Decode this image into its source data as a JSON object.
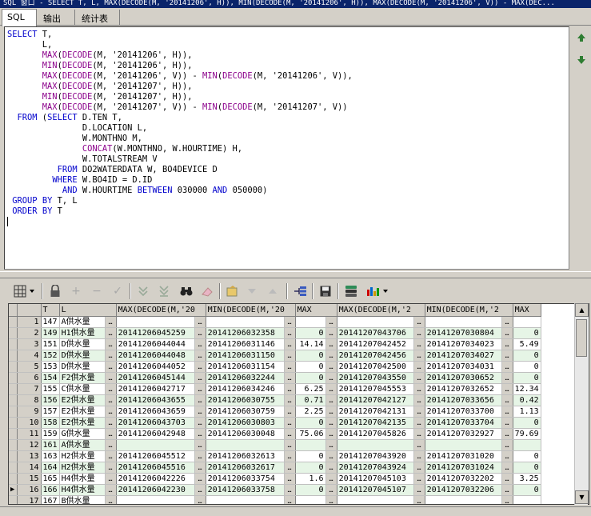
{
  "window": {
    "title": "SQL 窗口 - SELECT T, L, MAX(DECODE(M, '20141206', H)), MIN(DECODE(M, '20141206', H)), MAX(DECODE(M, '20141206', V)) - MAX(DEC..."
  },
  "tabs": [
    {
      "label": "SQL"
    },
    {
      "label": "输出"
    },
    {
      "label": "统计表"
    }
  ],
  "editor": {
    "lines": [
      "SELECT T,",
      "       L,",
      "       MAX(DECODE(M, '20141206', H)),",
      "       MIN(DECODE(M, '20141206', H)),",
      "       MAX(DECODE(M, '20141206', V)) - MIN(DECODE(M, '20141206', V)),",
      "       MAX(DECODE(M, '20141207', H)),",
      "       MIN(DECODE(M, '20141207', H)),",
      "       MAX(DECODE(M, '20141207', V)) - MIN(DECODE(M, '20141207', V))",
      "  FROM (SELECT D.TEN T,",
      "               D.LOCATION L,",
      "               W.MONTHNO M,",
      "               CONCAT(W.MONTHNO, W.HOURTIME) H,",
      "               W.TOTALSTREAM V",
      "          FROM DO2WATERDATA W, BO4DEVICE D",
      "         WHERE W.BO4ID = D.ID",
      "           AND W.HOURTIME BETWEEN 030000 AND 050000)",
      " GROUP BY T, L",
      " ORDER BY T"
    ]
  },
  "side_nav": {
    "up_icon": "arrow-up-icon",
    "down_icon": "arrow-down-icon"
  },
  "toolbar": {
    "icons": [
      "grid-menu-icon",
      "lock-icon",
      "plus-icon",
      "minus-icon",
      "check-icon",
      "next-record-icon",
      "last-record-icon",
      "binoculars-icon",
      "eraser-icon",
      "fetch-icon",
      "dropdown-icon",
      "arrow-up-icon",
      "structure-icon",
      "save-icon",
      "export-icon",
      "chart-icon"
    ]
  },
  "grid": {
    "columns": [
      "T",
      "L",
      "MAX(DECODE(M,'20",
      "MIN(DECODE(M,'20",
      "MAX",
      "MAX(DECODE(M,'2",
      "MIN(DECODE(M,'2",
      "MAX"
    ],
    "current_row_marker": "▶",
    "rows": [
      {
        "n": "1",
        "t": "147",
        "l": "A供水量",
        "c3": "",
        "c4": "",
        "c5": "",
        "c6": "",
        "c7": "",
        "c8": ""
      },
      {
        "n": "2",
        "t": "149",
        "l": "H1供水量",
        "c3": "20141206045259",
        "c4": "20141206032358",
        "c5": "0",
        "c6": "20141207043706",
        "c7": "20141207030804",
        "c8": "0"
      },
      {
        "n": "3",
        "t": "151",
        "l": "D供水量",
        "c3": "20141206044044",
        "c4": "20141206031146",
        "c5": "14.14",
        "c6": "20141207042452",
        "c7": "20141207034023",
        "c8": "5.49"
      },
      {
        "n": "4",
        "t": "152",
        "l": "D供水量",
        "c3": "20141206044048",
        "c4": "20141206031150",
        "c5": "0",
        "c6": "20141207042456",
        "c7": "20141207034027",
        "c8": "0"
      },
      {
        "n": "5",
        "t": "153",
        "l": "D供水量",
        "c3": "20141206044052",
        "c4": "20141206031154",
        "c5": "0",
        "c6": "20141207042500",
        "c7": "20141207034031",
        "c8": "0"
      },
      {
        "n": "6",
        "t": "154",
        "l": "F2供水量",
        "c3": "20141206045144",
        "c4": "20141206032244",
        "c5": "0",
        "c6": "20141207043550",
        "c7": "20141207030652",
        "c8": "0"
      },
      {
        "n": "7",
        "t": "155",
        "l": "C供水量",
        "c3": "20141206042717",
        "c4": "20141206034246",
        "c5": "6.25",
        "c6": "20141207045553",
        "c7": "20141207032652",
        "c8": "12.34"
      },
      {
        "n": "8",
        "t": "156",
        "l": "E2供水量",
        "c3": "20141206043655",
        "c4": "20141206030755",
        "c5": "0.71",
        "c6": "20141207042127",
        "c7": "20141207033656",
        "c8": "0.42"
      },
      {
        "n": "9",
        "t": "157",
        "l": "E2供水量",
        "c3": "20141206043659",
        "c4": "20141206030759",
        "c5": "2.25",
        "c6": "20141207042131",
        "c7": "20141207033700",
        "c8": "1.13"
      },
      {
        "n": "10",
        "t": "158",
        "l": "E2供水量",
        "c3": "20141206043703",
        "c4": "20141206030803",
        "c5": "0",
        "c6": "20141207042135",
        "c7": "20141207033704",
        "c8": "0"
      },
      {
        "n": "11",
        "t": "159",
        "l": "G供水量",
        "c3": "20141206042948",
        "c4": "20141206030048",
        "c5": "75.06",
        "c6": "20141207045826",
        "c7": "20141207032927",
        "c8": "79.69"
      },
      {
        "n": "12",
        "t": "161",
        "l": "A供水量",
        "c3": "",
        "c4": "",
        "c5": "",
        "c6": "",
        "c7": "",
        "c8": ""
      },
      {
        "n": "13",
        "t": "163",
        "l": "H2供水量",
        "c3": "20141206045512",
        "c4": "20141206032613",
        "c5": "0",
        "c6": "20141207043920",
        "c7": "20141207031020",
        "c8": "0"
      },
      {
        "n": "14",
        "t": "164",
        "l": "H2供水量",
        "c3": "20141206045516",
        "c4": "20141206032617",
        "c5": "0",
        "c6": "20141207043924",
        "c7": "20141207031024",
        "c8": "0"
      },
      {
        "n": "15",
        "t": "165",
        "l": "H4供水量",
        "c3": "20141206042226",
        "c4": "20141206033754",
        "c5": "1.6",
        "c6": "20141207045103",
        "c7": "20141207032202",
        "c8": "3.25"
      },
      {
        "n": "16",
        "t": "166",
        "l": "H4供水量",
        "c3": "20141206042230",
        "c4": "20141206033758",
        "c5": "0",
        "c6": "20141207045107",
        "c7": "20141207032206",
        "c8": "0"
      },
      {
        "n": "17",
        "t": "167",
        "l": "B供水量",
        "c3": "",
        "c4": "",
        "c5": "",
        "c6": "",
        "c7": "",
        "c8": ""
      }
    ],
    "current_row": 15
  },
  "colors": {
    "alt_row": "#e6f5e6",
    "keyword": "#0000cc",
    "function": "#8b008b",
    "title_bg": "#0a246a"
  }
}
